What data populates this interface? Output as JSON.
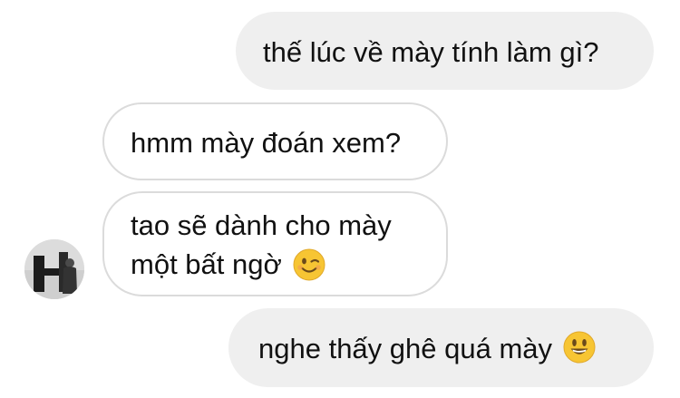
{
  "messages": [
    {
      "side": "outgoing",
      "text": "thế lúc về mày tính làm gì?"
    },
    {
      "side": "incoming",
      "text": "hmm mày đoán xem?"
    },
    {
      "side": "incoming",
      "lines": [
        "tao sẽ dành cho mày",
        "một bất ngờ"
      ],
      "emoji": "winking-face-emoji"
    },
    {
      "side": "outgoing",
      "text": "nghe thấy ghê quá mày",
      "emoji": "smiling-face-emoji"
    }
  ],
  "avatar": {
    "icon": "profile-photo"
  },
  "colors": {
    "outgoing_bubble": "#efefef",
    "incoming_border": "#dbdbdb",
    "text": "#111111",
    "emoji": "#f7c533"
  }
}
